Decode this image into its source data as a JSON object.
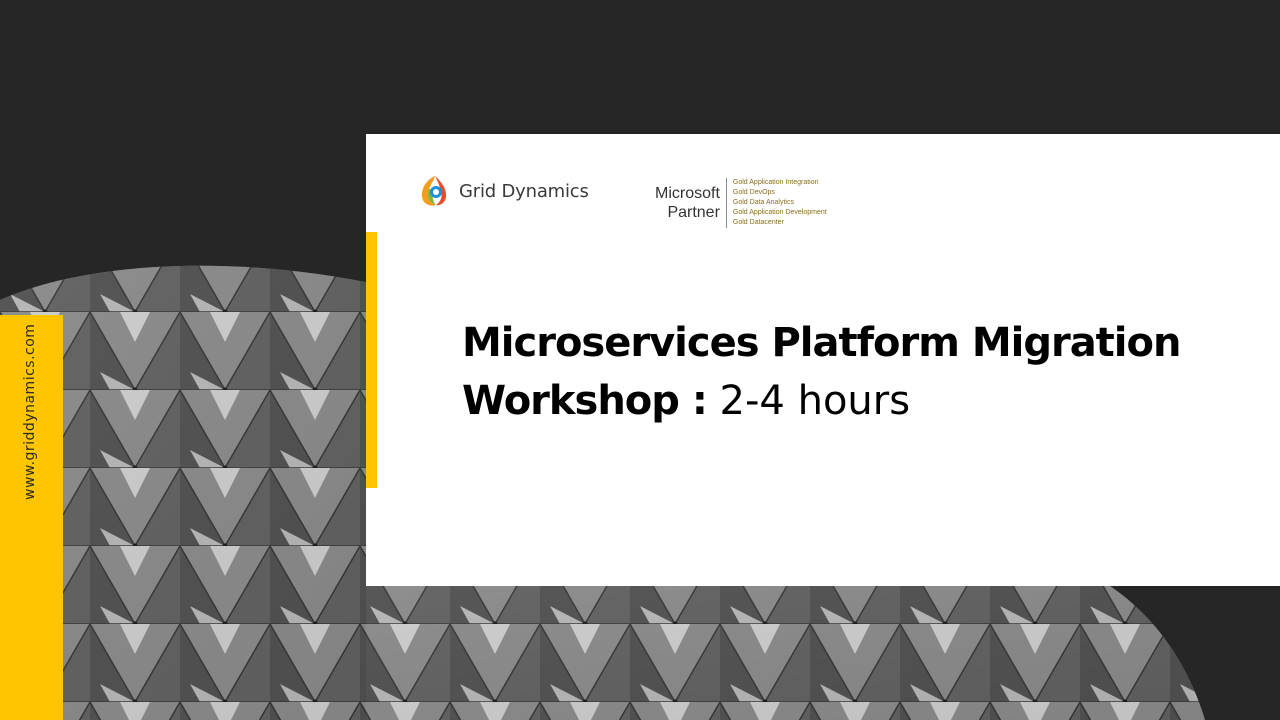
{
  "side": {
    "url": "www.griddynamics.com"
  },
  "brand": {
    "name": "Grid Dynamics"
  },
  "partner": {
    "line1": "Microsoft",
    "line2": "Partner",
    "competencies": [
      "Gold Application Integration",
      "Gold DevOps",
      "Gold Data Analytics",
      "Gold Application Development",
      "Gold Datacenter"
    ]
  },
  "title": {
    "line1": "Microservices Platform Migration",
    "line2_bold": "Workshop :",
    "line2_light": "2-4 hours"
  },
  "colors": {
    "accent": "#ffc600",
    "background": "#262626",
    "partner_text": "#8a6d1c"
  }
}
